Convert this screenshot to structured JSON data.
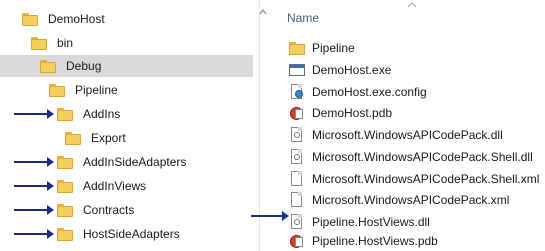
{
  "tree": {
    "items": [
      {
        "label": "DemoHost",
        "arrow": false
      },
      {
        "label": "bin",
        "arrow": false
      },
      {
        "label": "Debug",
        "selected": true,
        "arrow": false
      },
      {
        "label": "Pipeline",
        "arrow": false
      },
      {
        "label": "AddIns",
        "arrow": true
      },
      {
        "label": "Export",
        "arrow": false
      },
      {
        "label": "AddInSideAdapters",
        "arrow": true
      },
      {
        "label": "AddInViews",
        "arrow": true
      },
      {
        "label": "Contracts",
        "arrow": true
      },
      {
        "label": "HostSideAdapters",
        "arrow": true
      }
    ]
  },
  "files": {
    "column_header": "Name",
    "items": [
      {
        "name": "Pipeline",
        "icon": "folder-icon"
      },
      {
        "name": "DemoHost.exe",
        "icon": "exe-icon"
      },
      {
        "name": "DemoHost.exe.config",
        "icon": "config-file-icon"
      },
      {
        "name": "DemoHost.pdb",
        "icon": "pdb-file-icon"
      },
      {
        "name": "Microsoft.WindowsAPICodePack.dll",
        "icon": "dll-file-icon"
      },
      {
        "name": "Microsoft.WindowsAPICodePack.Shell.dll",
        "icon": "dll-file-icon"
      },
      {
        "name": "Microsoft.WindowsAPICodePack.Shell.xml",
        "icon": "xml-file-icon"
      },
      {
        "name": "Microsoft.WindowsAPICodePack.xml",
        "icon": "xml-file-icon"
      },
      {
        "name": "Pipeline.HostViews.dll",
        "icon": "dll-file-icon",
        "arrow": true
      },
      {
        "name": "Pipeline.HostViews.pdb",
        "icon": "pdb-file-icon"
      }
    ]
  },
  "colors": {
    "selection": "#d9d9d9",
    "arrow": "#1d2a8a",
    "folder": "#f4cf5c"
  }
}
